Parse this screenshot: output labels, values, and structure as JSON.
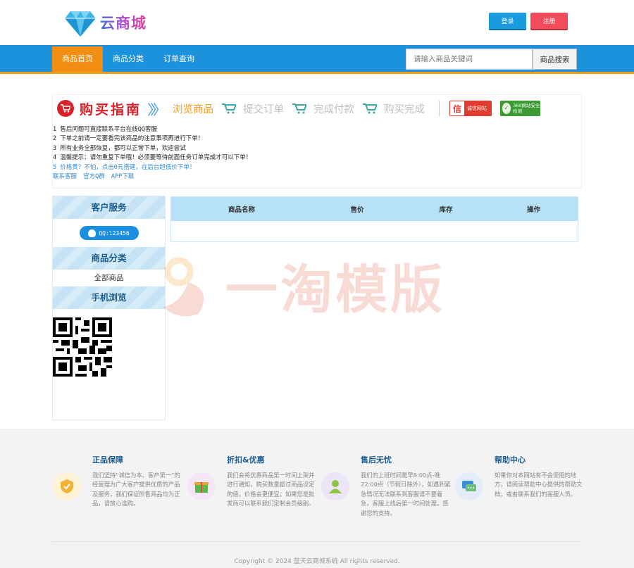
{
  "header": {
    "brand": "云商城",
    "login_label": "登录",
    "register_label": "注册"
  },
  "nav": {
    "items": [
      {
        "label": "商品首页"
      },
      {
        "label": "商品分类"
      },
      {
        "label": "订单查询"
      }
    ],
    "search_placeholder": "请输入商品关键词",
    "search_button": "商品搜索"
  },
  "guide": {
    "title": "购买指南",
    "steps": [
      "浏览商品",
      "提交订单",
      "完成付款",
      "购买完成"
    ],
    "badge_xin_text": "诚信网站",
    "badge_360_text": "360网站安全检测",
    "notes": [
      "1 售后问题可直接联系平台在线QQ客服",
      "2 下单之前请一定要看完该商品的注意事项再进行下单！",
      "3 所有业务全部恢复，都可以正常下单，欢迎尝试",
      "4 温馨提示：请勿重复下单哦！必须要等待前面任务订单完成才可以下单！",
      "5 价格贵？不怕，点击0元搭建，在后台超低价下单！"
    ],
    "links": [
      "联系客服",
      "官方Q群",
      "APP下载"
    ]
  },
  "sidebar": {
    "service_title": "客户服务",
    "qq_label": "QQ:123456",
    "category_title": "商品分类",
    "all_goods": "全部商品",
    "mobile_title": "手机浏览"
  },
  "table": {
    "headers": [
      "商品名称",
      "售价",
      "库存",
      "操作"
    ]
  },
  "watermark": "一淘模版",
  "footer": {
    "columns": [
      {
        "title": "正品保障",
        "text": "我们坚持“诚信为本、客户第一”的经营理为广大客户提供优质的产品及服务，我们保证所售商品均为正品，请放心选购。",
        "icon": "shield-icon",
        "color": "#f5b335"
      },
      {
        "title": "折扣&优惠",
        "text": "我们会将优惠商品第一时间上架并进行通知，购买数量超过商品设定的值，价格会更便宜，如果您是批发商可以联系我们定制会员级别。",
        "icon": "gift-icon",
        "color": "#58b94a"
      },
      {
        "title": "售后无忧",
        "text": "我们的上班时间是早8:00点-晚22:00点（节假日除外），如遇到紧急情况无法联系到客服请不要着急，客服上线后第一时间处理，感谢您的支持。",
        "icon": "user-icon",
        "color": "#8cc63f"
      },
      {
        "title": "帮助中心",
        "text": "如果你对本网站有不会使用的地方，请阅读帮助中心提供的帮助文档，或者联系我们的客服人员。",
        "icon": "chat-icon",
        "color": "#3a8fd8"
      }
    ],
    "copyright": "Copyright © 2024 蓝天云商城系统 All rights reserved."
  },
  "colors": {
    "nav_bg": "#1d92dc",
    "nav_active": "#f38e14",
    "guide_red": "#d7222a",
    "footer_title": "#1c5c93"
  }
}
